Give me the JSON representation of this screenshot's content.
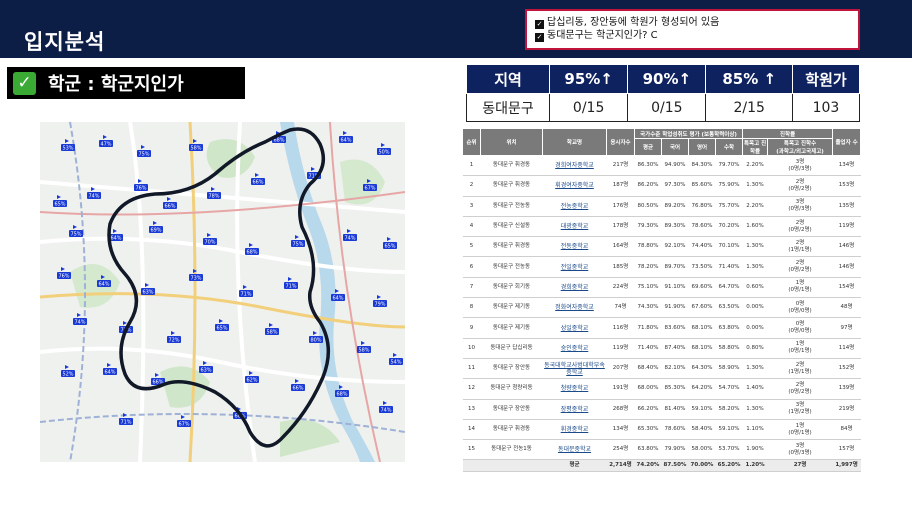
{
  "page": {
    "title": "입지분석",
    "notes": [
      "답십리동, 장안동에 학원가 형성되어 있음",
      "동대문구는 학군지인가? C"
    ],
    "badge_label": "학군 : 학군지인가"
  },
  "map": {
    "school_pins": [
      "53%",
      "47%",
      "75%",
      "58%",
      "68%",
      "64%",
      "50%",
      "65%",
      "74%",
      "76%",
      "66%",
      "78%",
      "66%",
      "71%",
      "67%",
      "75%",
      "64%",
      "69%",
      "70%",
      "68%",
      "75%",
      "74%",
      "65%",
      "76%",
      "64%",
      "63%",
      "73%",
      "71%",
      "71%",
      "64%",
      "79%",
      "74%",
      "71%",
      "72%",
      "65%",
      "58%",
      "80%",
      "58%",
      "54%",
      "52%",
      "64%",
      "66%",
      "63%",
      "62%",
      "66%",
      "68%",
      "74%",
      "71%",
      "67%",
      "60%"
    ]
  },
  "summary": {
    "headers": [
      "지역",
      "95%↑",
      "90%↑",
      "85% ↑",
      "학원가"
    ],
    "row": [
      "동대문구",
      "0/15",
      "0/15",
      "2/15",
      "103"
    ]
  },
  "detail": {
    "group_headers": {
      "eval": "국가수준 학업성취도 평가 (보통학력이상)",
      "progress": "진학률"
    },
    "headers": [
      "순위",
      "위치",
      "학교명",
      "응시자수",
      "평균",
      "국어",
      "영어",
      "수학",
      "특목고 진학률",
      "특목고 진학수",
      "졸업자 수"
    ],
    "sub_note": "(과학고/외고국제고)",
    "rows": [
      [
        "1",
        "동대문구 휘경동",
        "경희여자중학교",
        "217명",
        "86.30%",
        "94.90%",
        "84.30%",
        "79.70%",
        "2.20%",
        "3명",
        "(0명/3명)",
        "134명"
      ],
      [
        "2",
        "동대문구 휘경동",
        "휘경여자중학교",
        "187명",
        "86.20%",
        "97.30%",
        "85.60%",
        "75.90%",
        "1.30%",
        "2명",
        "(0명/2명)",
        "153명"
      ],
      [
        "3",
        "동대문구 전농동",
        "전농중학교",
        "176명",
        "80.50%",
        "89.20%",
        "76.80%",
        "75.70%",
        "2.20%",
        "3명",
        "(0명/3명)",
        "135명"
      ],
      [
        "4",
        "동대문구 신설동",
        "대광중학교",
        "178명",
        "79.30%",
        "89.30%",
        "78.60%",
        "70.20%",
        "1.60%",
        "2명",
        "(0명/2명)",
        "119명"
      ],
      [
        "5",
        "동대문구 휘경동",
        "전동중학교",
        "164명",
        "78.80%",
        "92.10%",
        "74.40%",
        "70.10%",
        "1.30%",
        "2명",
        "(1명/1명)",
        "146명"
      ],
      [
        "6",
        "동대문구 전농동",
        "전일중학교",
        "185명",
        "78.20%",
        "89.70%",
        "73.50%",
        "71.40%",
        "1.30%",
        "2명",
        "(0명/2명)",
        "146명"
      ],
      [
        "7",
        "동대문구 회기동",
        "경희중학교",
        "224명",
        "75.10%",
        "91.10%",
        "69.60%",
        "64.70%",
        "0.60%",
        "1명",
        "(0명/1명)",
        "154명"
      ],
      [
        "8",
        "동대문구 제기동",
        "정화여자중학교",
        "74명",
        "74.30%",
        "91.90%",
        "67.60%",
        "63.50%",
        "0.00%",
        "0명",
        "(0명/0명)",
        "48명"
      ],
      [
        "9",
        "동대문구 제기동",
        "성일중학교",
        "116명",
        "71.80%",
        "83.60%",
        "68.10%",
        "63.80%",
        "0.00%",
        "0명",
        "(0명/0명)",
        "97명"
      ],
      [
        "10",
        "동대문구 답십리동",
        "숭인중학교",
        "119명",
        "71.40%",
        "87.40%",
        "68.10%",
        "58.80%",
        "0.80%",
        "1명",
        "(0명/1명)",
        "114명"
      ],
      [
        "11",
        "동대문구 장안동",
        "동국대학교사범대학부속중학교",
        "207명",
        "68.40%",
        "82.10%",
        "64.30%",
        "58.90%",
        "1.30%",
        "2명",
        "(1명/1명)",
        "152명"
      ],
      [
        "12",
        "동대문구 청량리동",
        "청량중학교",
        "191명",
        "68.00%",
        "85.30%",
        "64.20%",
        "54.70%",
        "1.40%",
        "2명",
        "(0명/2명)",
        "139명"
      ],
      [
        "13",
        "동대문구 장안동",
        "장평중학교",
        "268명",
        "66.20%",
        "81.40%",
        "59.10%",
        "58.20%",
        "1.30%",
        "3명",
        "(1명/2명)",
        "219명"
      ],
      [
        "14",
        "동대문구 휘경동",
        "휘경중학교",
        "134명",
        "65.30%",
        "78.60%",
        "58.40%",
        "59.10%",
        "1.10%",
        "1명",
        "(0명/1명)",
        "84명"
      ],
      [
        "15",
        "동대문구 전농1동",
        "동대문중학교",
        "254명",
        "63.80%",
        "79.90%",
        "58.00%",
        "53.70%",
        "1.90%",
        "3명",
        "(0명/3명)",
        "157명"
      ]
    ],
    "average": [
      "평균",
      "2,714명",
      "74.20%",
      "87.50%",
      "70.00%",
      "65.20%",
      "1.20%",
      "27명",
      "1,997명"
    ]
  },
  "colors": {
    "header_navy": "#0d1e46",
    "table_navy": "#0f2260",
    "note_border": "#c0143c",
    "check_green": "#3aaa35",
    "pin_blue": "#1a3ad6"
  }
}
